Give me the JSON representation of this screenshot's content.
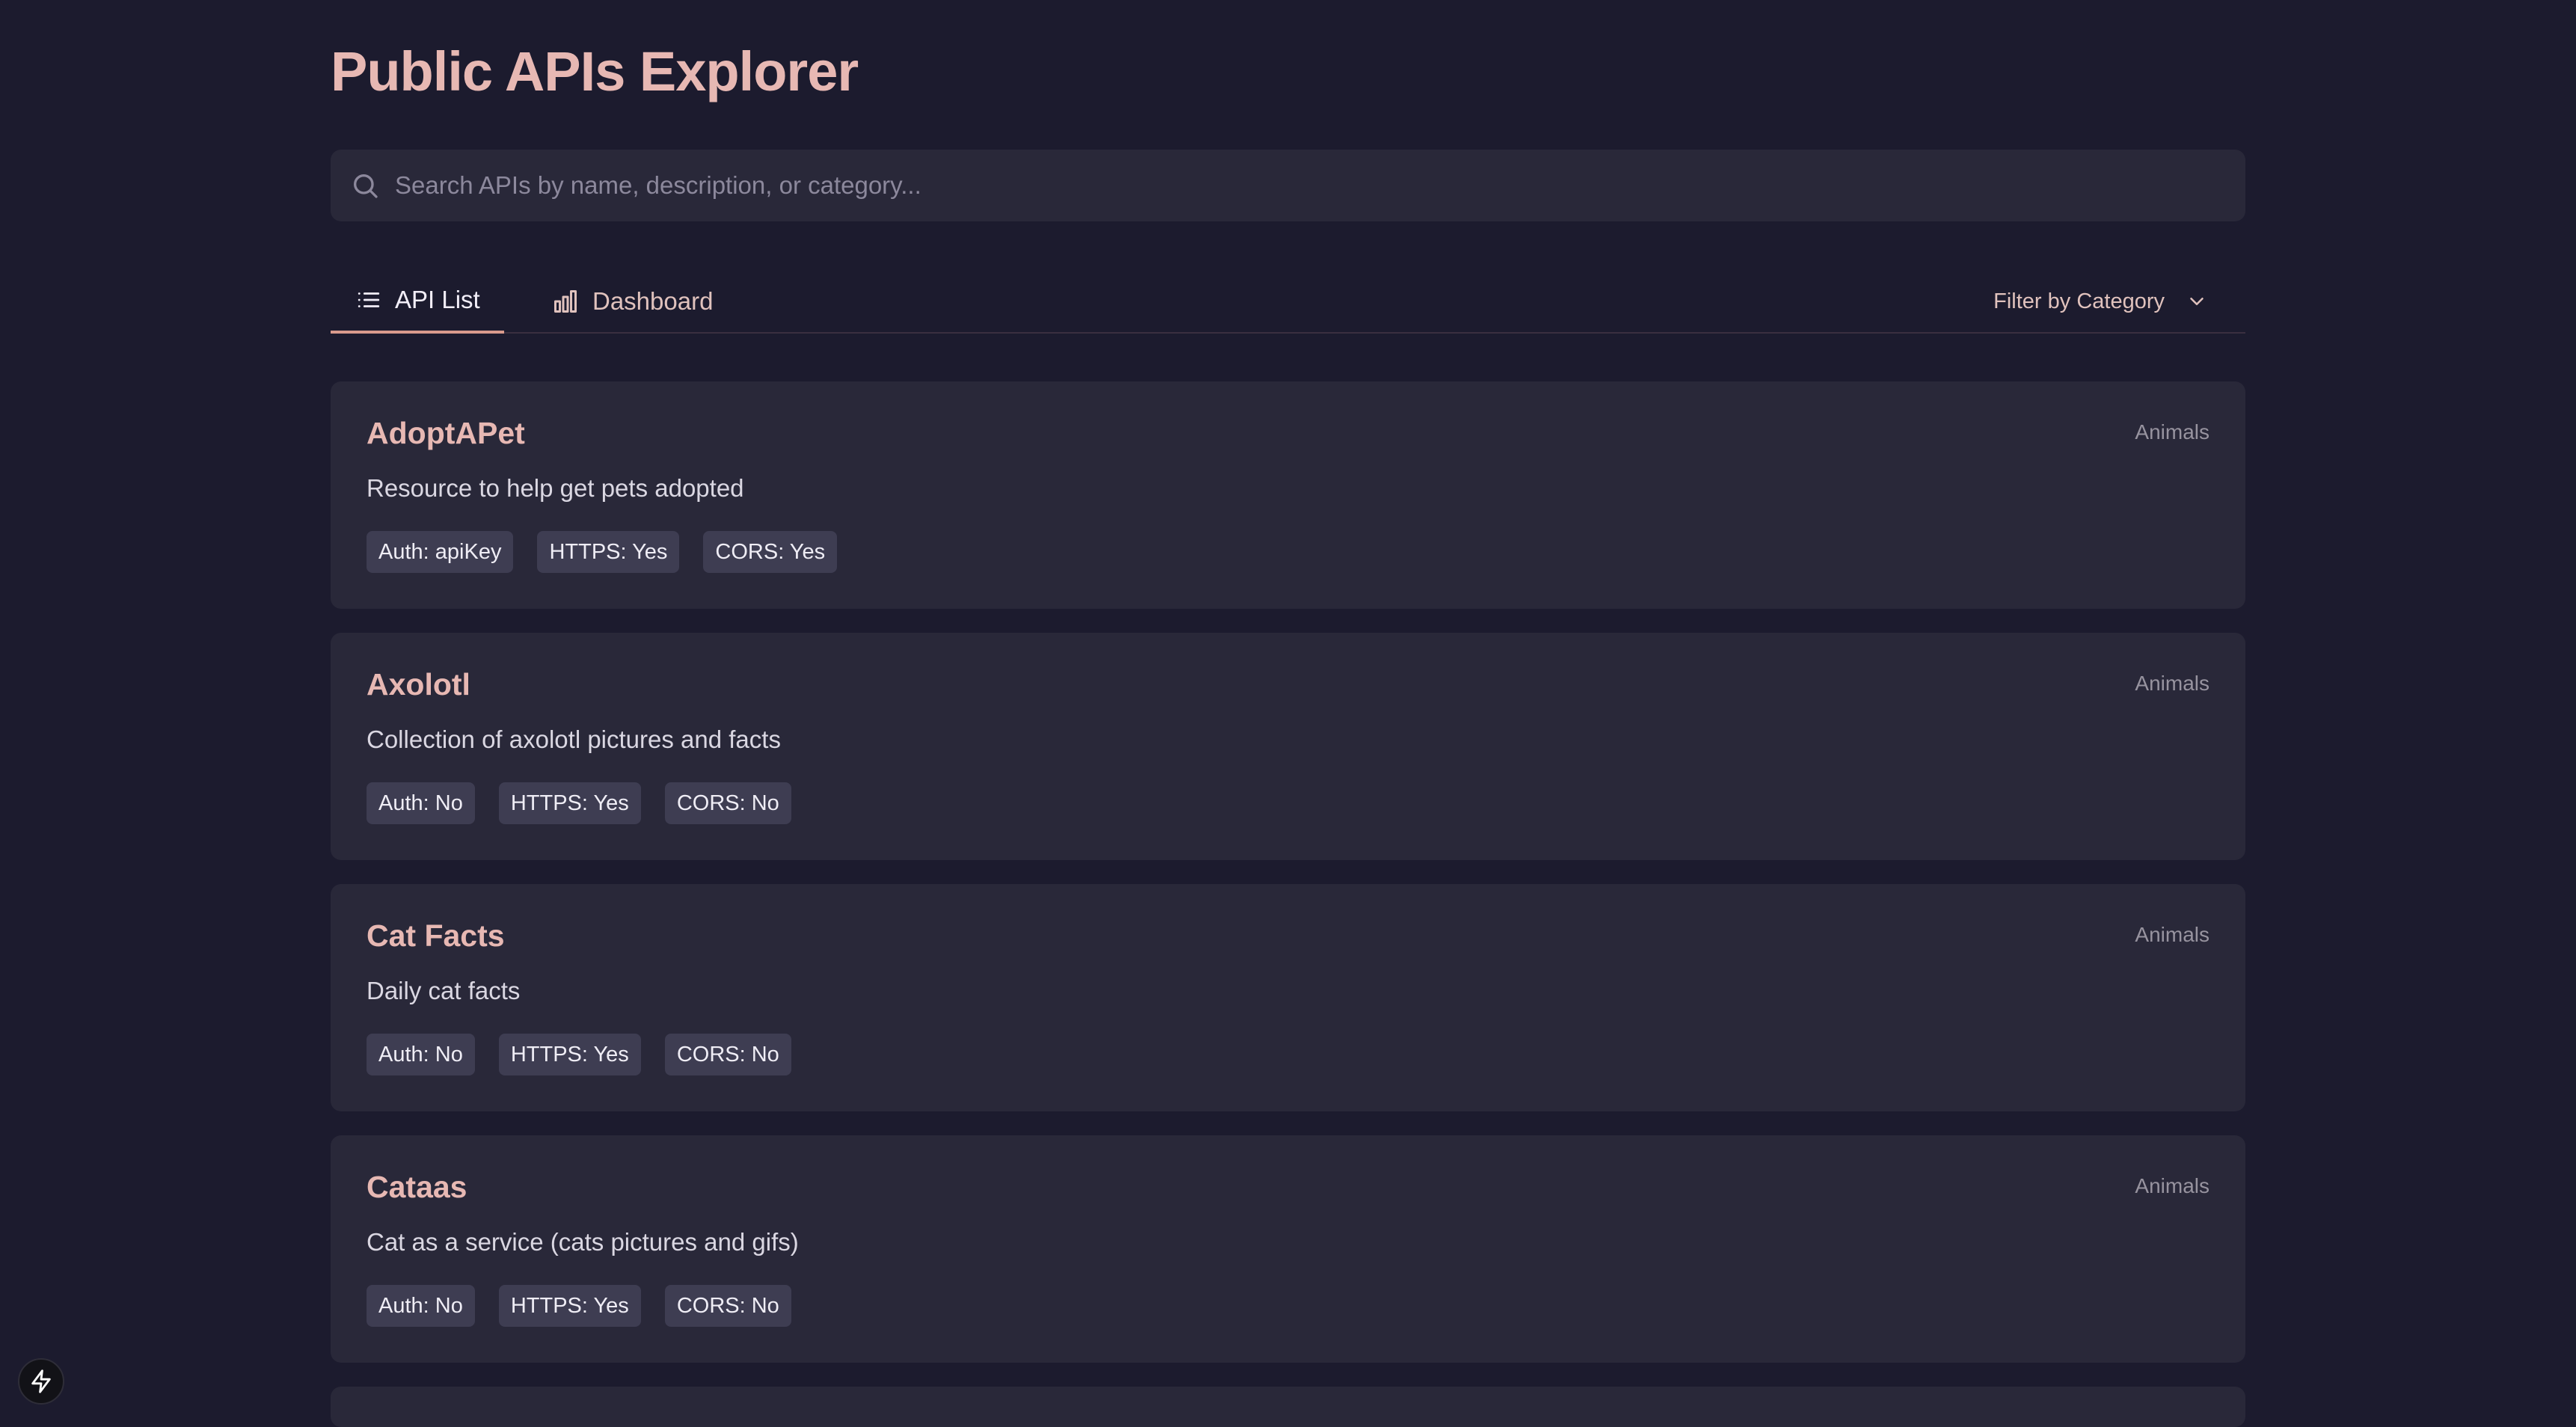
{
  "header": {
    "title": "Public APIs Explorer"
  },
  "search": {
    "placeholder": "Search APIs by name, description, or category...",
    "value": ""
  },
  "tabs": [
    {
      "label": "API List",
      "icon": "list-icon",
      "active": true
    },
    {
      "label": "Dashboard",
      "icon": "bar-chart-icon",
      "active": false
    }
  ],
  "filter": {
    "label": "Filter by Category",
    "icon": "chevron-down-icon"
  },
  "apis": [
    {
      "name": "AdoptAPet",
      "description": "Resource to help get pets adopted",
      "category": "Animals",
      "badges": [
        "Auth: apiKey",
        "HTTPS: Yes",
        "CORS: Yes"
      ]
    },
    {
      "name": "Axolotl",
      "description": "Collection of axolotl pictures and facts",
      "category": "Animals",
      "badges": [
        "Auth: No",
        "HTTPS: Yes",
        "CORS: No"
      ]
    },
    {
      "name": "Cat Facts",
      "description": "Daily cat facts",
      "category": "Animals",
      "badges": [
        "Auth: No",
        "HTTPS: Yes",
        "CORS: No"
      ]
    },
    {
      "name": "Cataas",
      "description": "Cat as a service (cats pictures and gifs)",
      "category": "Animals",
      "badges": [
        "Auth: No",
        "HTTPS: Yes",
        "CORS: No"
      ]
    }
  ],
  "colors": {
    "background": "#1c1b2e",
    "card": "#292839",
    "accent": "#e7b8b3",
    "badge": "#3e3d52"
  }
}
